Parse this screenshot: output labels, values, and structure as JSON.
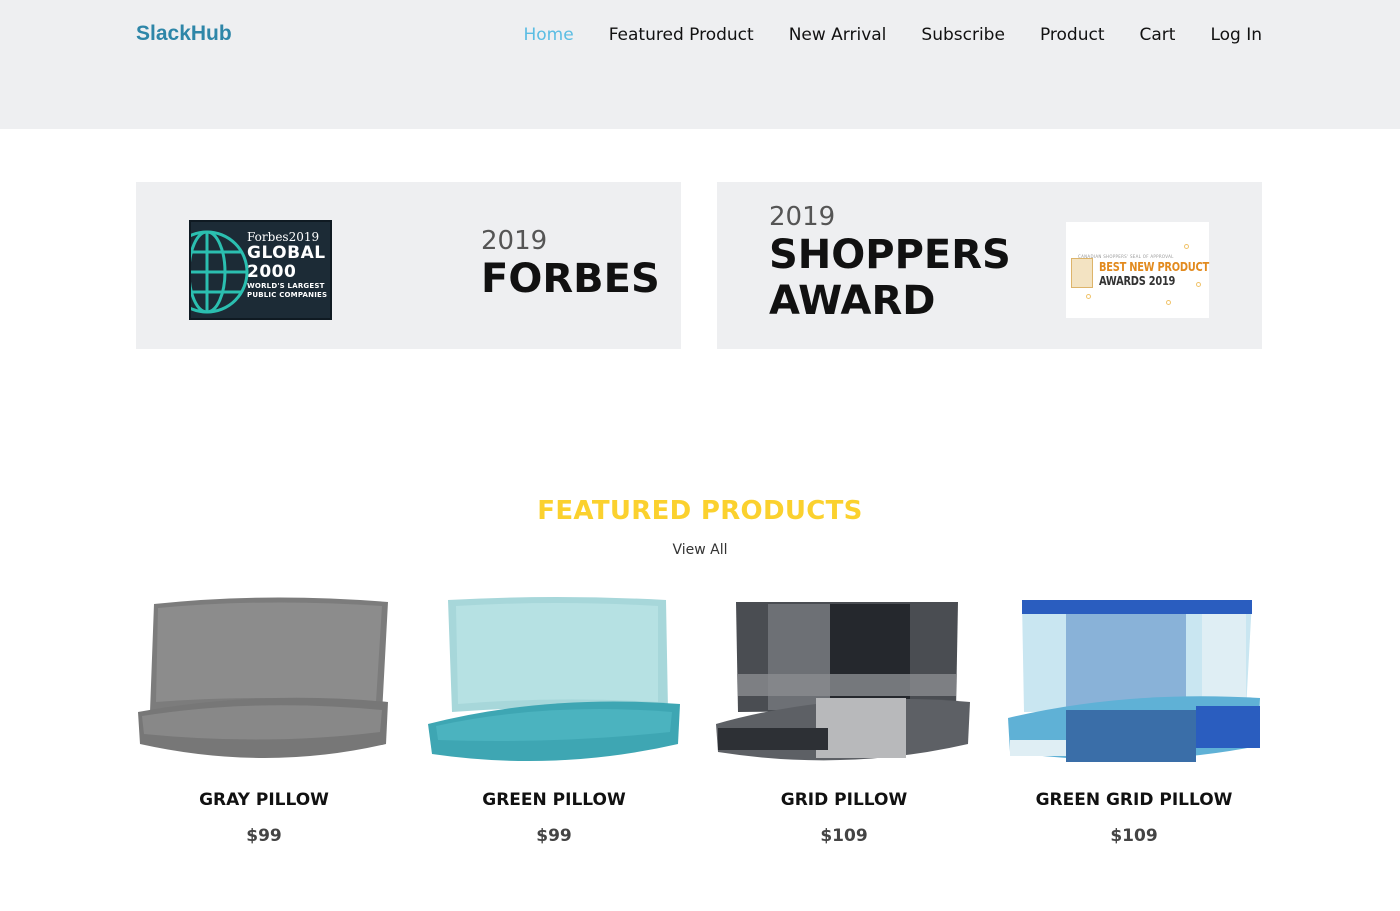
{
  "header": {
    "logo": "SlackHub",
    "nav": [
      {
        "label": "Home",
        "active": true
      },
      {
        "label": "Featured Product",
        "active": false
      },
      {
        "label": "New Arrival",
        "active": false
      },
      {
        "label": "Subscribe",
        "active": false
      },
      {
        "label": "Product",
        "active": false
      },
      {
        "label": "Cart",
        "active": false
      },
      {
        "label": "Log In",
        "active": false
      }
    ]
  },
  "awards": [
    {
      "year": "2019",
      "title": "FORBES",
      "badge": {
        "line1": "Forbes2019",
        "line2": "GLOBAL",
        "line3": "2000",
        "line4": "WORLD'S LARGEST",
        "line5": "PUBLIC COMPANIES"
      }
    },
    {
      "year": "2019",
      "title_line1": "SHOPPERS",
      "title_line2": "AWARD",
      "badge": {
        "top": "CANADIAN SHOPPERS' SEAL OF APPROVAL",
        "line1": "BEST NEW PRODUCT",
        "line2": "AWARDS 2019"
      }
    }
  ],
  "featured": {
    "title": "FEATURED PRODUCTS",
    "view_all": "View All",
    "products": [
      {
        "name": "GRAY PILLOW",
        "price": "$99"
      },
      {
        "name": "GREEN PILLOW",
        "price": "$99"
      },
      {
        "name": "GRID PILLOW",
        "price": "$109"
      },
      {
        "name": "GREEN GRID PILLOW",
        "price": "$109"
      }
    ]
  },
  "colors": {
    "header_bg": "#eeeff1",
    "logo": "#2e86a8",
    "nav_active": "#5bbde3",
    "featured_title": "#fbd12e"
  }
}
